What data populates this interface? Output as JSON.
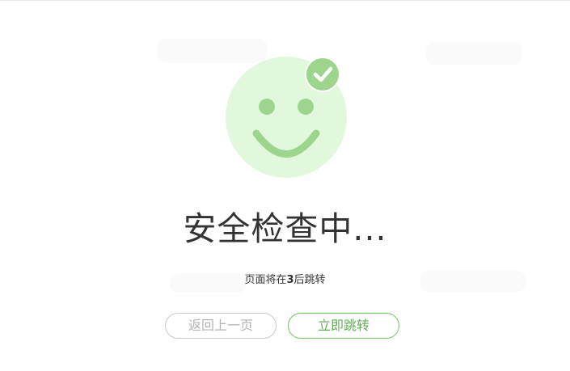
{
  "title": "安全检查中...",
  "redirect": {
    "prefix": "页面将在",
    "seconds": "3",
    "suffix": "后跳转"
  },
  "buttons": {
    "back_label": "返回上一页",
    "go_label": "立即跳转"
  },
  "icons": {
    "face": "smiley-face-icon",
    "badge": "check-badge-icon"
  },
  "colors": {
    "face_bg": "#e2f8dc",
    "accent_green": "#9ed58c",
    "button_green": "#5fae52",
    "button_gray": "#b3b3b3",
    "text": "#333333"
  }
}
